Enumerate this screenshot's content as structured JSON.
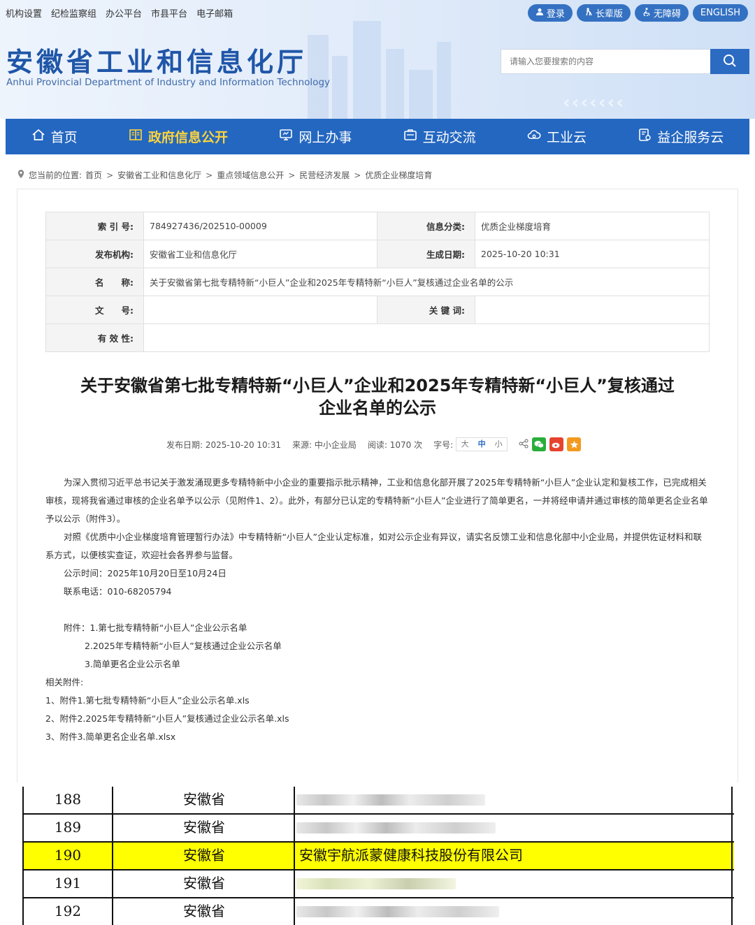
{
  "topbar": [
    "机构设置",
    "纪检监察组",
    "办公平台",
    "市县平台",
    "电子邮箱"
  ],
  "toplinks": [
    {
      "label": "登录",
      "icon": "user-icon"
    },
    {
      "label": "长辈版",
      "icon": "elder-icon"
    },
    {
      "label": "无障碍",
      "icon": "accessibility-icon"
    },
    {
      "label": "ENGLISH",
      "icon": ""
    }
  ],
  "site": {
    "title_cn": "安徽省工业和信息化厅",
    "title_en": "Anhui Provincial Department of Industry and Information Technology"
  },
  "search": {
    "placeholder": "请输入您要搜索的内容"
  },
  "nav": [
    {
      "label": "首页",
      "icon": "home-icon",
      "active": false
    },
    {
      "label": "政府信息公开",
      "icon": "book-icon",
      "active": true
    },
    {
      "label": "网上办事",
      "icon": "monitor-icon",
      "active": false
    },
    {
      "label": "互动交流",
      "icon": "chat-icon",
      "active": false
    },
    {
      "label": "工业云",
      "icon": "cloud-icon",
      "active": false
    },
    {
      "label": "益企服务云",
      "icon": "service-icon",
      "active": false
    }
  ],
  "breadcrumb": {
    "prefix": "您当前的位置:",
    "items": [
      "首页",
      "安徽省工业和信息化厅",
      "重点领域信息公开",
      "民营经济发展",
      "优质企业梯度培育"
    ]
  },
  "meta": {
    "index_label": "索 引 号:",
    "index_value": "784927436/202510-00009",
    "category_label": "信息分类:",
    "category_value": "优质企业梯度培育",
    "org_label": "发布机构:",
    "org_value": "安徽省工业和信息化厅",
    "date_label": "生成日期:",
    "date_value": "2025-10-20 10:31",
    "name_label": "名　　称:",
    "name_value": "关于安徽省第七批专精特新“小巨人”企业和2025年专精特新“小巨人”复核通过企业名单的公示",
    "doc_label": "文　　号:",
    "doc_value": "",
    "keyword_label": "关 键 词:",
    "keyword_value": "",
    "valid_label": "有 效 性:",
    "valid_value": ""
  },
  "article": {
    "title_line1": "关于安徽省第七批专精特新“小巨人”企业和2025年专精特新“小巨人”复核通过",
    "title_line2": "企业名单的公示",
    "publish": "发布日期: 2025-10-20 10:31",
    "source": "来源: 中小企业局",
    "reads": "阅读: 1070 次",
    "fontsize_label": "字号:",
    "fontsizes": [
      "大",
      "中",
      "小"
    ],
    "p1": "为深入贯彻习近平总书记关于激发涌现更多专精特新中小企业的重要指示批示精神，工业和信息化部开展了2025年专精特新“小巨人”企业认定和复核工作，已完成相关审核，现将我省通过审核的企业名单予以公示（见附件1、2）。此外，有部分已认定的专精特新“小巨人”企业进行了简单更名，一并将经申请并通过审核的简单更名企业名单予以公示（附件3）。",
    "p2": "对照《优质中小企业梯度培育管理暂行办法》中专精特新“小巨人”企业认定标准，如对公示企业有异议，请实名反馈工业和信息化部中小企业局，并提供佐证材料和联系方式，以便核实查证，欢迎社会各界参与监督。",
    "p3": "公示时间：2025年10月20日至10月24日",
    "p4": "联系电话：010-68205794",
    "att1": "附件：1.第七批专精特新“小巨人”企业公示名单",
    "att2": "2.2025年专精特新“小巨人”复核通过企业公示名单",
    "att3": "3.简单更名企业公示名单",
    "related_label": "相关附件:",
    "related": [
      "1、附件1.第七批专精特新“小巨人”企业公示名单.xls",
      "2、附件2.2025年专精特新“小巨人”复核通过企业公示名单.xls",
      "3、附件3.简单更名企业名单.xlsx"
    ]
  },
  "sheet": {
    "rows": [
      {
        "no": "188",
        "province": "安徽省",
        "company": "",
        "highlight": false
      },
      {
        "no": "189",
        "province": "安徽省",
        "company": "",
        "highlight": false
      },
      {
        "no": "190",
        "province": "安徽省",
        "company": "安徽宇航派蒙健康科技股份有限公司",
        "highlight": true
      },
      {
        "no": "191",
        "province": "安徽省",
        "company": "",
        "highlight": false
      },
      {
        "no": "192",
        "province": "安徽省",
        "company": "",
        "highlight": false
      }
    ],
    "highlight_color": "#ffff00"
  },
  "colors": {
    "nav_bg": "#2467c0",
    "nav_active": "#ffd43a",
    "brand": "#1f56a8",
    "pill": "#3471c2"
  }
}
